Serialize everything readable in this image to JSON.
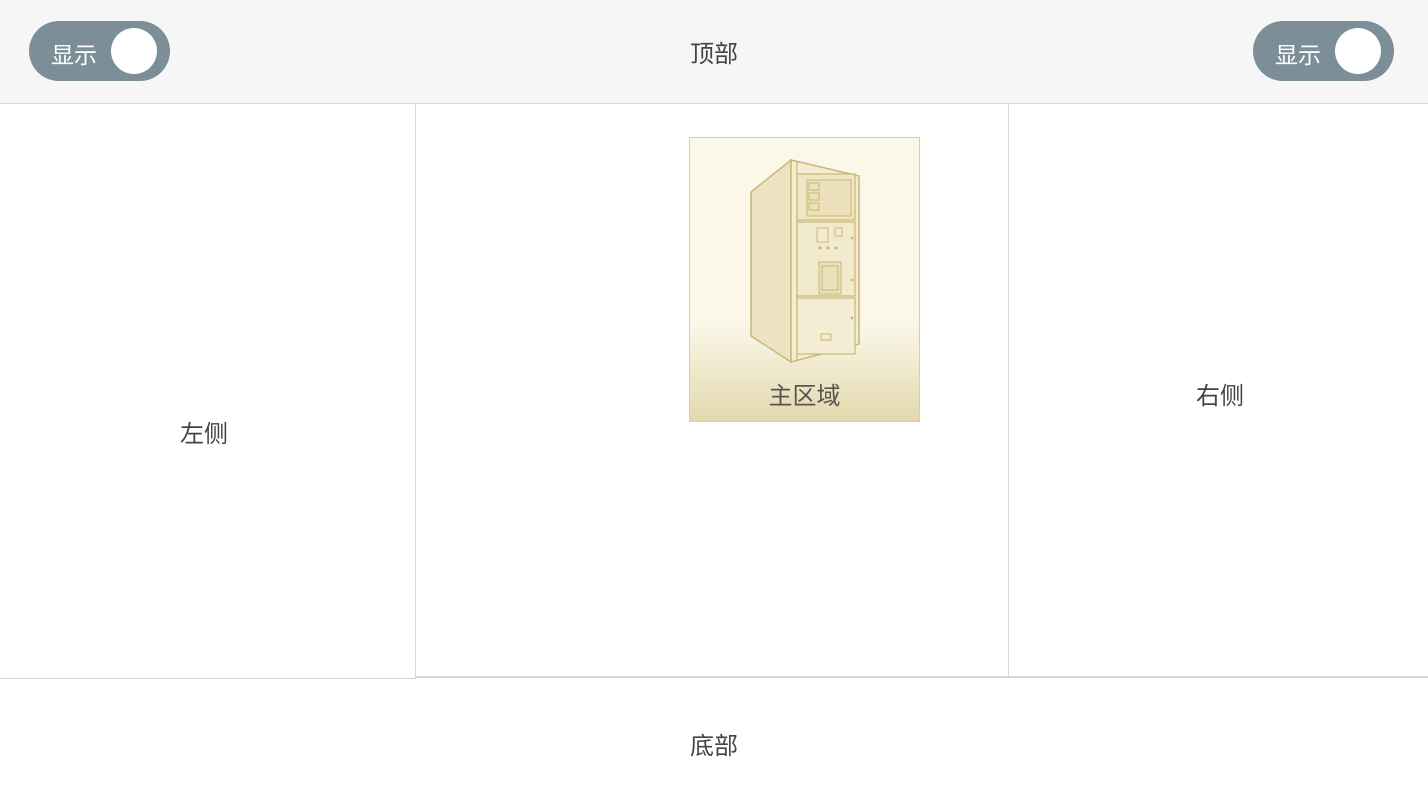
{
  "top": {
    "title": "顶部",
    "left_toggle": {
      "label": "显示"
    },
    "right_toggle": {
      "label": "显示"
    }
  },
  "left": {
    "label": "左侧"
  },
  "main": {
    "card": {
      "label": "主区域",
      "icon": "switchgear-cabinet-icon"
    }
  },
  "right": {
    "label": "右侧"
  },
  "bottom": {
    "label": "底部"
  },
  "colors": {
    "toggle_bg": "#7c8f98",
    "header_bg": "#f6f6f6",
    "card_gradient_end": "#e3d9ad"
  }
}
